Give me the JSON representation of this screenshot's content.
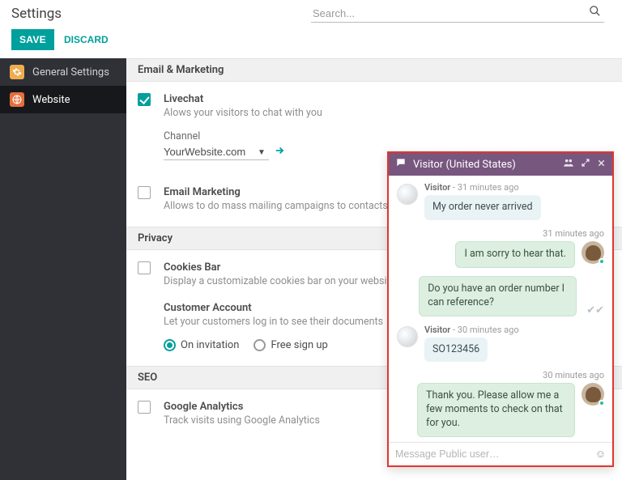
{
  "header": {
    "title": "Settings",
    "search_placeholder": "Search...",
    "save_label": "SAVE",
    "discard_label": "DISCARD"
  },
  "sidebar": {
    "items": [
      {
        "label": "General Settings"
      },
      {
        "label": "Website"
      }
    ]
  },
  "sections": {
    "email_marketing": {
      "title": "Email & Marketing",
      "livechat": {
        "title": "Livechat",
        "desc": "Alows your visitors to chat with you",
        "channel_label": "Channel",
        "channel_value": "YourWebsite.com"
      },
      "email_marketing": {
        "title": "Email Marketing",
        "desc": "Allows to do mass mailing campaigns to contacts"
      }
    },
    "privacy": {
      "title": "Privacy",
      "cookies": {
        "title": "Cookies Bar",
        "desc": "Display a customizable cookies bar on your website"
      },
      "account": {
        "title": "Customer Account",
        "desc": "Let your customers log in to see their documents",
        "radio_invitation": "On invitation",
        "radio_free": "Free sign up"
      }
    },
    "seo": {
      "title": "SEO",
      "ga": {
        "title": "Google Analytics",
        "desc": "Track visits using Google Analytics"
      }
    }
  },
  "chat": {
    "title": "Visitor (United States)",
    "input_placeholder": "Message Public user…",
    "messages": [
      {
        "side": "visitor",
        "who": "Visitor",
        "time": "- 31 minutes ago",
        "text": "My order never arrived"
      },
      {
        "side": "agent",
        "time": "31 minutes ago",
        "text": "I am sorry to hear that."
      },
      {
        "side": "agent",
        "text": "Do you have an order number I can reference?"
      },
      {
        "side": "visitor",
        "who": "Visitor",
        "time": "- 30 minutes ago",
        "text": "SO123456"
      },
      {
        "side": "agent",
        "time": "30 minutes ago",
        "text": "Thank you. Please allow me a few moments to check on that for you."
      }
    ]
  }
}
